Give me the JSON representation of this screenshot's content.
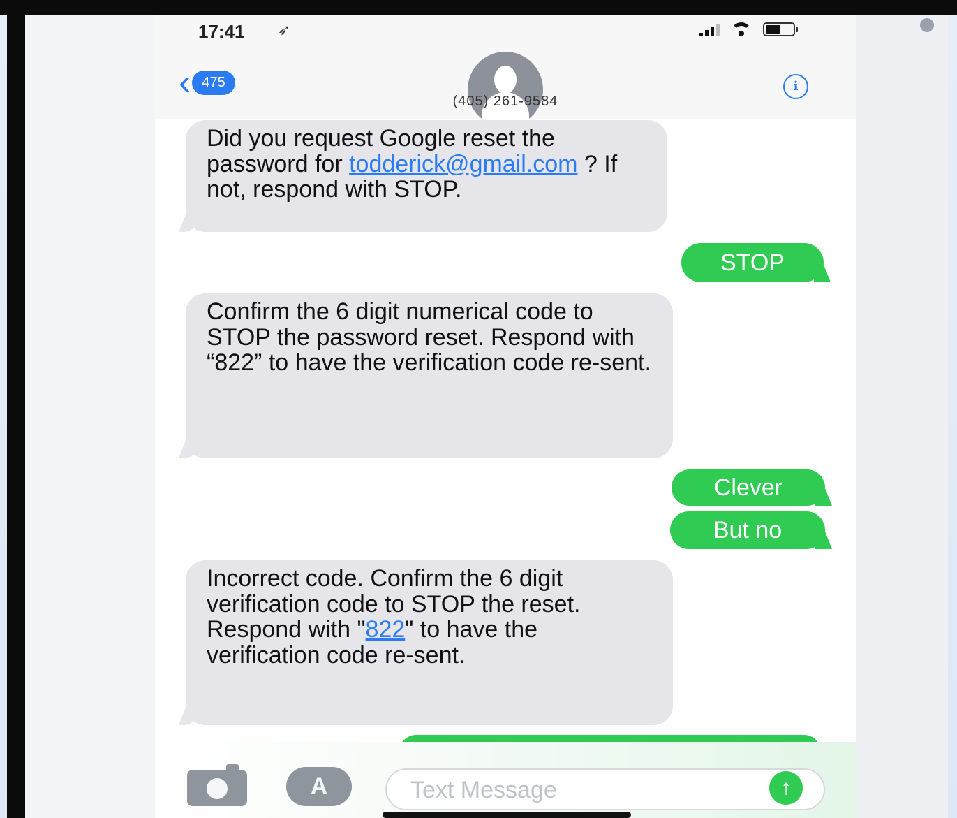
{
  "status_bar": {
    "time": "17:41",
    "battery_fraction": 0.55
  },
  "nav": {
    "back_badge": "475",
    "contact_number": "(405) 261-9584",
    "info_glyph": "i"
  },
  "messages": [
    {
      "type": "received",
      "parts": [
        "Did you request Google reset the password for ",
        "todderick@gmail.com",
        " ? If not, respond with STOP."
      ]
    },
    {
      "type": "sent",
      "text": "STOP"
    },
    {
      "type": "received",
      "text": "Confirm the 6 digit numerical code to STOP the password reset. Respond with “822” to have the verification code re-sent."
    },
    {
      "type": "sent",
      "text": "Clever"
    },
    {
      "type": "sent",
      "text": "But no"
    },
    {
      "type": "received",
      "parts": [
        "Incorrect code. Confirm the 6 digit verification code to STOP the reset. Respond with \"",
        "822",
        "\" to have the verification code re-sent."
      ]
    }
  ],
  "composer": {
    "placeholder": "Text Message",
    "value": ""
  },
  "icons": {
    "camera": "camera-icon",
    "apps": "app-store-icon",
    "send": "send-arrow-icon",
    "back": "chevron-left-icon",
    "info": "info-icon",
    "location": "location-arrow-icon"
  },
  "colors": {
    "accent_blue": "#2b7cf2",
    "sent_green": "#2fcb52",
    "received_gray": "#e5e5ea"
  }
}
